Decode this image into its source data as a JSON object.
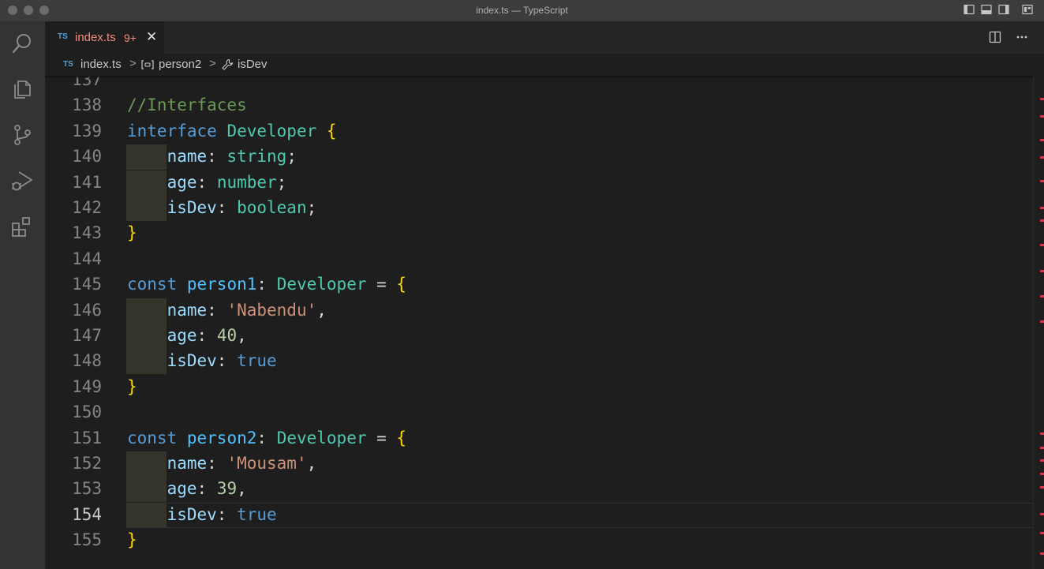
{
  "window": {
    "title": "index.ts — TypeScript"
  },
  "tab": {
    "lang_badge": "TS",
    "filename": "index.ts",
    "problem_count": "9+",
    "close_glyph": "✕"
  },
  "breadcrumb": {
    "lang_badge": "TS",
    "file": "index.ts",
    "symbol_1": "person2",
    "symbol_2": "isDev",
    "separator": ">"
  },
  "editor": {
    "active_line": "154",
    "lines": [
      {
        "n": "137",
        "tokens": []
      },
      {
        "n": "138",
        "tokens": [
          [
            "c-comment",
            "//Interfaces"
          ]
        ]
      },
      {
        "n": "139",
        "tokens": [
          [
            "c-kw",
            "interface"
          ],
          [
            "c-punc",
            " "
          ],
          [
            "c-type",
            "Developer"
          ],
          [
            "c-punc",
            " "
          ],
          [
            "c-brace",
            "{"
          ]
        ]
      },
      {
        "n": "140",
        "tokens": [
          [
            "c-punc",
            "    "
          ],
          [
            "c-prop",
            "name"
          ],
          [
            "c-punc",
            ": "
          ],
          [
            "c-type",
            "string"
          ],
          [
            "c-punc",
            ";"
          ]
        ]
      },
      {
        "n": "141",
        "tokens": [
          [
            "c-punc",
            "    "
          ],
          [
            "c-prop",
            "age"
          ],
          [
            "c-punc",
            ": "
          ],
          [
            "c-type",
            "number"
          ],
          [
            "c-punc",
            ";"
          ]
        ]
      },
      {
        "n": "142",
        "tokens": [
          [
            "c-punc",
            "    "
          ],
          [
            "c-prop",
            "isDev"
          ],
          [
            "c-punc",
            ": "
          ],
          [
            "c-type",
            "boolean"
          ],
          [
            "c-punc",
            ";"
          ]
        ]
      },
      {
        "n": "143",
        "tokens": [
          [
            "c-brace",
            "}"
          ]
        ]
      },
      {
        "n": "144",
        "tokens": []
      },
      {
        "n": "145",
        "tokens": [
          [
            "c-kw",
            "const"
          ],
          [
            "c-punc",
            " "
          ],
          [
            "c-var",
            "person1"
          ],
          [
            "c-punc",
            ": "
          ],
          [
            "c-type",
            "Developer"
          ],
          [
            "c-punc",
            " = "
          ],
          [
            "c-brace",
            "{"
          ]
        ]
      },
      {
        "n": "146",
        "tokens": [
          [
            "c-punc",
            "    "
          ],
          [
            "c-prop",
            "name"
          ],
          [
            "c-punc",
            ": "
          ],
          [
            "c-str",
            "'Nabendu'"
          ],
          [
            "c-punc",
            ","
          ]
        ]
      },
      {
        "n": "147",
        "tokens": [
          [
            "c-punc",
            "    "
          ],
          [
            "c-prop",
            "age"
          ],
          [
            "c-punc",
            ": "
          ],
          [
            "c-num",
            "40"
          ],
          [
            "c-punc",
            ","
          ]
        ]
      },
      {
        "n": "148",
        "tokens": [
          [
            "c-punc",
            "    "
          ],
          [
            "c-prop",
            "isDev"
          ],
          [
            "c-punc",
            ": "
          ],
          [
            "c-kw",
            "true"
          ]
        ]
      },
      {
        "n": "149",
        "tokens": [
          [
            "c-brace",
            "}"
          ]
        ]
      },
      {
        "n": "150",
        "tokens": []
      },
      {
        "n": "151",
        "tokens": [
          [
            "c-kw",
            "const"
          ],
          [
            "c-punc",
            " "
          ],
          [
            "c-var",
            "person2"
          ],
          [
            "c-punc",
            ": "
          ],
          [
            "c-type",
            "Developer"
          ],
          [
            "c-punc",
            " = "
          ],
          [
            "c-brace",
            "{"
          ]
        ]
      },
      {
        "n": "152",
        "tokens": [
          [
            "c-punc",
            "    "
          ],
          [
            "c-prop",
            "name"
          ],
          [
            "c-punc",
            ": "
          ],
          [
            "c-str",
            "'Mousam'"
          ],
          [
            "c-punc",
            ","
          ]
        ]
      },
      {
        "n": "153",
        "tokens": [
          [
            "c-punc",
            "    "
          ],
          [
            "c-prop",
            "age"
          ],
          [
            "c-punc",
            ": "
          ],
          [
            "c-num",
            "39"
          ],
          [
            "c-punc",
            ","
          ]
        ]
      },
      {
        "n": "154",
        "tokens": [
          [
            "c-punc",
            "    "
          ],
          [
            "c-prop",
            "isDev"
          ],
          [
            "c-punc",
            ": "
          ],
          [
            "c-kw",
            "true"
          ]
        ]
      },
      {
        "n": "155",
        "tokens": [
          [
            "c-brace",
            "}"
          ]
        ]
      }
    ]
  },
  "icons": {
    "activity": [
      "search-icon",
      "files-icon",
      "source-control-icon",
      "run-debug-icon",
      "extensions-icon"
    ],
    "editor_actions": [
      "split-editor-icon",
      "more-actions-icon"
    ]
  },
  "colors": {
    "error_marker": "#d9344c",
    "ts_badge": "#4fa0d8",
    "tab_error_text": "#f08c7c"
  }
}
